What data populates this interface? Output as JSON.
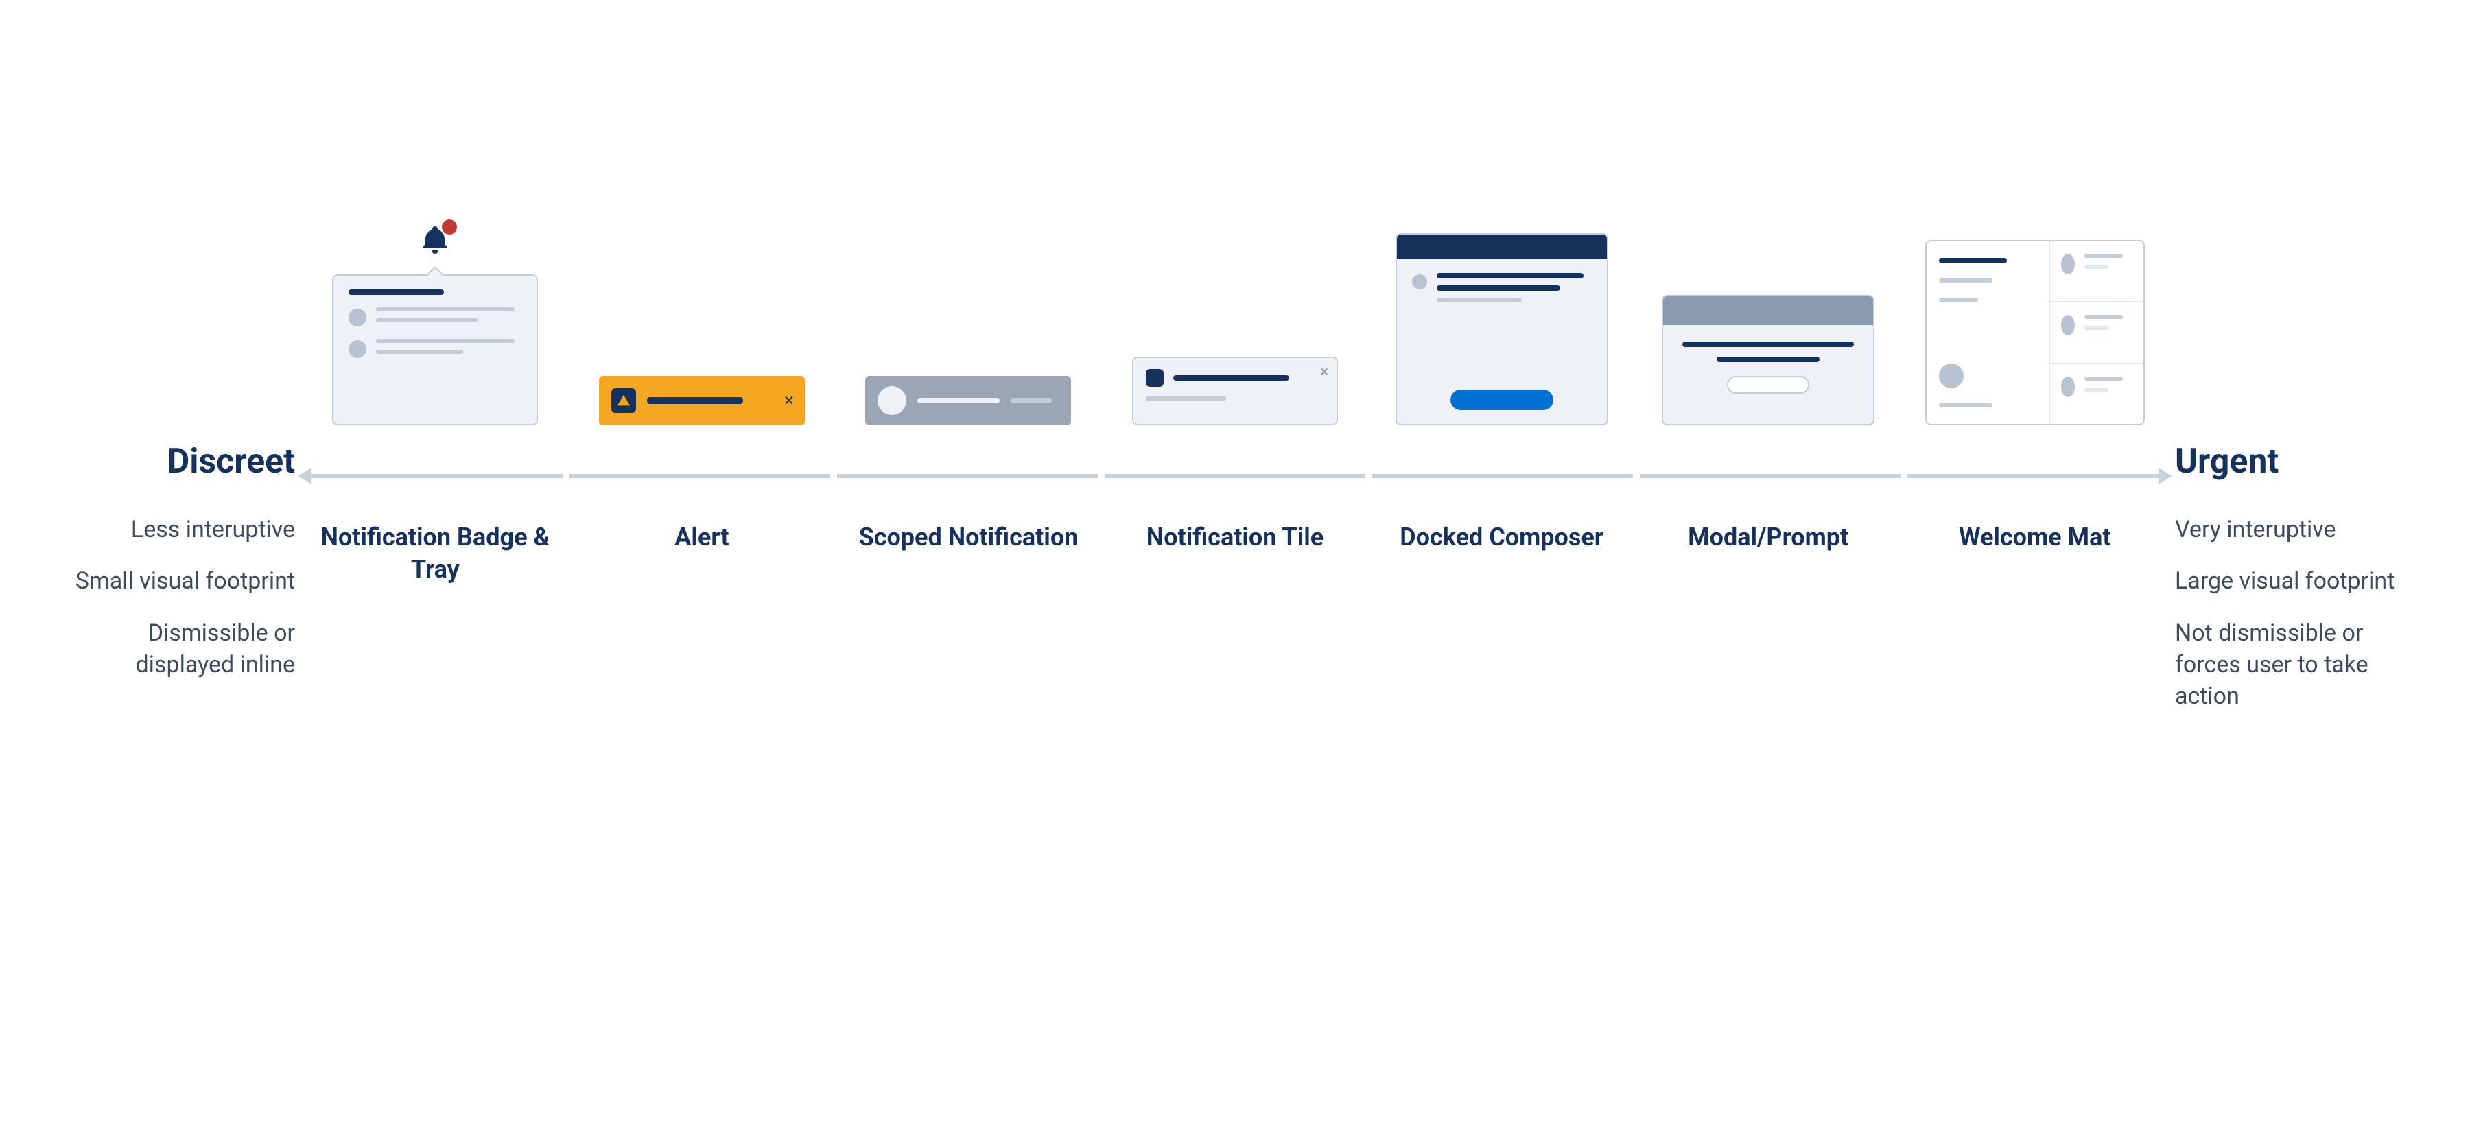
{
  "spectrum": {
    "left": {
      "heading": "Discreet",
      "bullets": [
        "Less interuptive",
        "Small visual footprint",
        "Dismissible or displayed inline"
      ]
    },
    "right": {
      "heading": "Urgent",
      "bullets": [
        "Very interuptive",
        "Large visual footprint",
        "Not dismissible or forces user to take action"
      ]
    }
  },
  "categories": [
    {
      "label": "Notification Badge & Tray"
    },
    {
      "label": "Alert"
    },
    {
      "label": "Scoped Notification"
    },
    {
      "label": "Notification Tile"
    },
    {
      "label": "Docked Composer"
    },
    {
      "label": "Modal/Prompt"
    },
    {
      "label": "Welcome Mat"
    }
  ],
  "icons": {
    "bell": "bell-icon",
    "warning": "warning-triangle-icon",
    "close": "close-icon"
  },
  "colors": {
    "navy": "#16325c",
    "grey": "#c4ccd8",
    "panel": "#eef1f6",
    "slate": "#9aa5b5",
    "amber": "#f5a623",
    "red": "#c23934",
    "blue": "#0070d2"
  }
}
